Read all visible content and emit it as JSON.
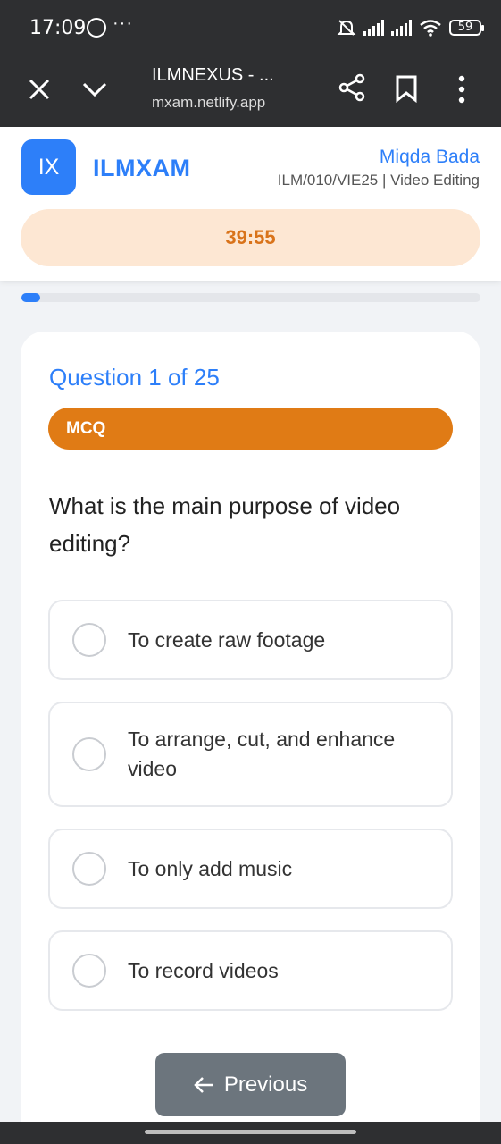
{
  "status_bar": {
    "time": "17:09",
    "more": "···",
    "battery": "59"
  },
  "browser": {
    "title": "ILMNEXUS - ...",
    "url": "mxam.netlify.app"
  },
  "app": {
    "logo_text": "IX",
    "brand_name": "ILMXAM",
    "user_name": "Miqda Bada",
    "user_code": "ILM/010/VIE25 | Video Editing",
    "timer": "39:55",
    "progress_fraction": 0.04,
    "accent_color": "#2d7ff9",
    "badge_color": "#e07b15"
  },
  "question": {
    "number_label": "Question 1 of 25",
    "type_label": "MCQ",
    "text": "What is the main purpose of video editing?",
    "options": [
      {
        "label": "To create raw footage"
      },
      {
        "label": "To arrange, cut, and enhance video"
      },
      {
        "label": "To only add music"
      },
      {
        "label": "To record videos"
      }
    ]
  },
  "navigation": {
    "previous_label": "Previous"
  }
}
